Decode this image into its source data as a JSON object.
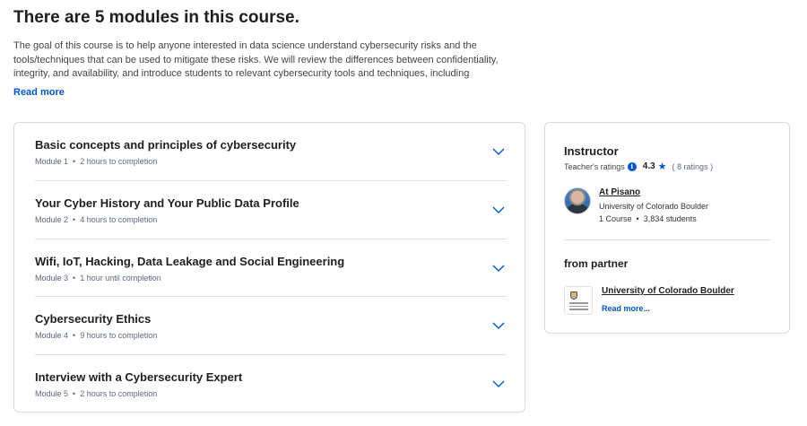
{
  "header": {
    "title": "There are 5 modules in this course."
  },
  "description": {
    "text": "The goal of this course is to help anyone interested in data science understand cybersecurity risks and the tools/techniques that can be used to mitigate these risks. We will review the differences between confidentiality, integrity, and availability, and introduce students to relevant cybersecurity tools and techniques, including cryptographic tools, software resources, and policies that will be needed for data",
    "read_more": "Read more"
  },
  "modules": [
    {
      "title": "Basic concepts and principles of cybersecurity",
      "module": "Module 1",
      "duration": "2 hours to completion"
    },
    {
      "title": "Your Cyber History and Your Public Data Profile",
      "module": "Module 2",
      "duration": "4 hours to completion"
    },
    {
      "title": "Wifi, IoT, Hacking, Data Leakage and Social Engineering",
      "module": "Module 3",
      "duration": "1 hour until completion"
    },
    {
      "title": "Cybersecurity Ethics",
      "module": "Module 4",
      "duration": "9 hours to completion"
    },
    {
      "title": "Interview with a Cybersecurity Expert",
      "module": "Module 5",
      "duration": "2 hours to completion"
    }
  ],
  "meta_separator": "•",
  "instructor": {
    "heading": "Instructor",
    "ratings_label": "Teacher's ratings",
    "info_icon": "i",
    "rating_value": "4.3",
    "star_icon": "★",
    "rating_count": "( 8 ratings )",
    "name": "At Pisano",
    "organization": "University of Colorado Boulder",
    "courses": "1 Course",
    "students": "3,834 students"
  },
  "partner": {
    "heading": "from partner",
    "name": "University of Colorado Boulder",
    "read_more": "Read more..."
  },
  "colors": {
    "accent": "#0056d2",
    "text": "#1f1f1f",
    "muted": "#5b6780",
    "border": "#dadada"
  }
}
